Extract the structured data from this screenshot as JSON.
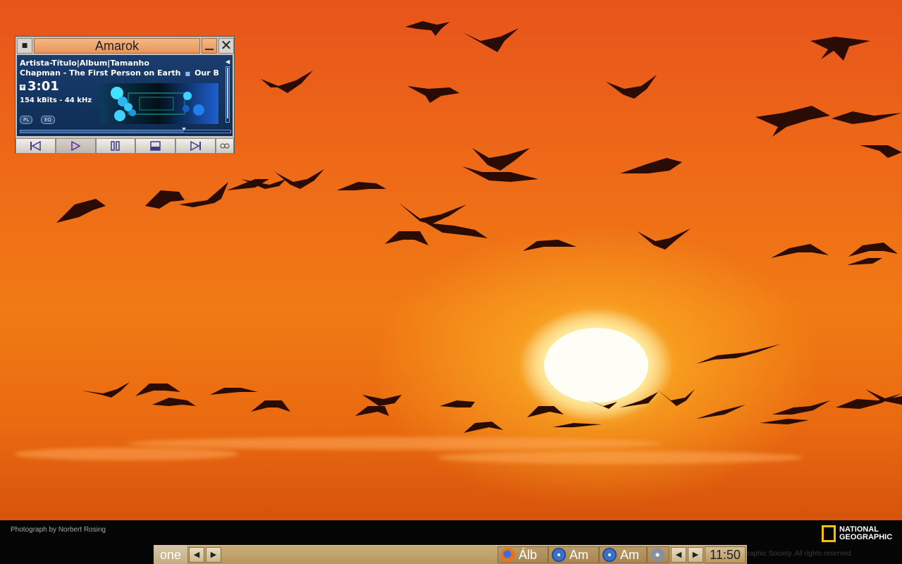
{
  "desktop": {
    "photo_credit": "Photograph by Norbert Rosing",
    "copyright_partial": "nal Geographic Society. All rights reserved.",
    "brand_line1": "NATIONAL",
    "brand_line2": "GEOGRAPHIC",
    "brand_color": "#f4c200"
  },
  "amarok_window": {
    "title": "Amarok",
    "menu_icon": "window-menu-icon",
    "minimize_icon": "minimize-icon",
    "close_icon": "close-icon",
    "column_header": "Artista-Título|Album|Tamanho",
    "track_text": "Chapman - The First Person on Earth",
    "track_overflow": "Our B",
    "time": "3:01",
    "bitrate": "154 kBits - 44 kHz",
    "pl_label": "PL",
    "eq_label": "EQ",
    "volume_level": 0.95,
    "seek_progress": 0.78,
    "controls": [
      {
        "name": "previous-button",
        "icon": "skip-back-icon"
      },
      {
        "name": "play-button",
        "icon": "play-icon"
      },
      {
        "name": "pause-button",
        "icon": "pause-icon"
      },
      {
        "name": "stop-button",
        "icon": "stop-icon"
      },
      {
        "name": "next-button",
        "icon": "skip-forward-icon"
      }
    ],
    "extra_icon": "visualization-icon",
    "accent": "#12345f"
  },
  "taskbar": {
    "desktop_label": "one",
    "tasks": [
      {
        "label": "Álb",
        "icon": "firefox-icon"
      },
      {
        "label": "Am",
        "icon": "amarok-icon"
      },
      {
        "label": "Am",
        "icon": "amarok-icon"
      }
    ],
    "clock": "11:50",
    "color": "#b8975e"
  }
}
